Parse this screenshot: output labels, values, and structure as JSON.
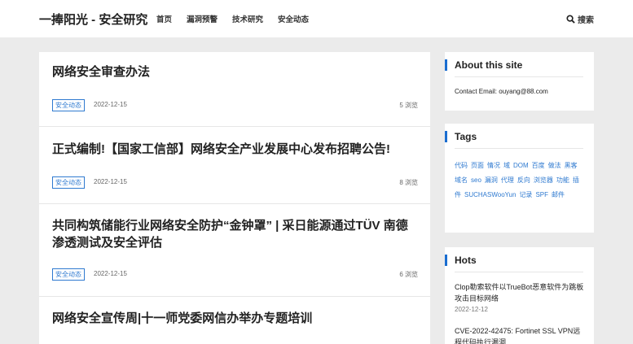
{
  "site": {
    "title": "一捧阳光 - 安全研究"
  },
  "nav": [
    "首页",
    "漏洞预警",
    "技术研究",
    "安全动态"
  ],
  "search": {
    "label": "搜索"
  },
  "posts": [
    {
      "title": "网络安全审查办法",
      "category": "安全动态",
      "date": "2022-12-15",
      "views": "5 浏览"
    },
    {
      "title": "正式编制!【国家工信部】网络安全产业发展中心发布招聘公告!",
      "category": "安全动态",
      "date": "2022-12-15",
      "views": "8 浏览"
    },
    {
      "title": "共同构筑储能行业网络安全防护“金钟罩” | 采日能源通过TÜV 南德渗透测试及安全评估",
      "category": "安全动态",
      "date": "2022-12-15",
      "views": "6 浏览"
    },
    {
      "title": "网络安全宣传周|十一师党委网信办举办专题培训"
    }
  ],
  "sidebar": {
    "about": {
      "title": "About this site",
      "contact": "Contact Email: ouyang@88.com"
    },
    "tags": {
      "title": "Tags",
      "items": [
        "代码",
        "页面",
        "情况",
        "域",
        "DOM",
        "百度",
        "做法",
        "黑客",
        "域名",
        "seo",
        "漏洞",
        "代理",
        "反向",
        "浏览器",
        "功能",
        "插件",
        "SUCHASWooYun",
        "记录",
        "SPF",
        "邮件"
      ]
    },
    "hots": {
      "title": "Hots",
      "items": [
        {
          "title": "Clop勒索软件以TrueBot恶意软件为跳板攻击目标网络",
          "date": "2022-12-12"
        },
        {
          "title": "CVE-2022-42475: Fortinet SSL VPN远程代码执行漏洞"
        }
      ]
    }
  },
  "colors": {
    "accent": "#1a6dd0",
    "link": "#2f7ad0",
    "background": "#ebebeb"
  }
}
